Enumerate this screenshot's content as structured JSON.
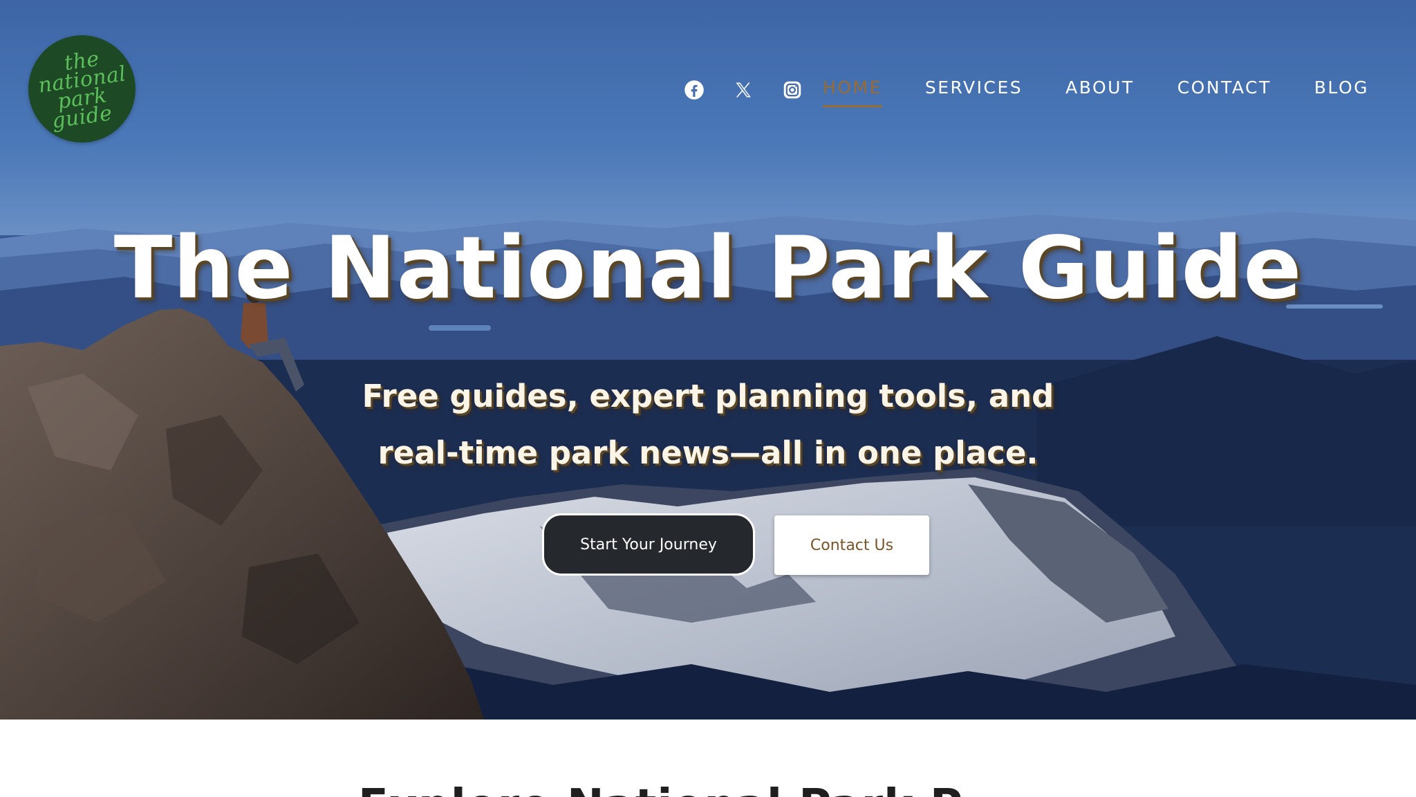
{
  "logo": {
    "lines": [
      "the",
      "national",
      "park",
      "guide"
    ]
  },
  "social": [
    {
      "name": "facebook",
      "icon": "facebook-icon"
    },
    {
      "name": "x",
      "icon": "x-icon"
    },
    {
      "name": "instagram",
      "icon": "instagram-icon"
    }
  ],
  "nav": {
    "items": [
      {
        "label": "HOME",
        "active": true
      },
      {
        "label": "SERVICES"
      },
      {
        "label": "ABOUT"
      },
      {
        "label": "CONTACT"
      },
      {
        "label": "BLOG"
      }
    ]
  },
  "hero": {
    "title": "The National Park Guide",
    "subtitle_lines": [
      "Free guides, expert planning tools, and",
      "real-time park news—all in one place."
    ],
    "primary_button": "Start Your Journey",
    "secondary_button": "Contact Us"
  },
  "section": {
    "heading_partial": "Explore National Park P"
  },
  "colors": {
    "nav_active": "#9a6c31",
    "logo_bg": "#1d4a25",
    "logo_text": "#5cbf5c",
    "primary_button_bg": "#25282c",
    "secondary_button_text": "#7a5426"
  }
}
